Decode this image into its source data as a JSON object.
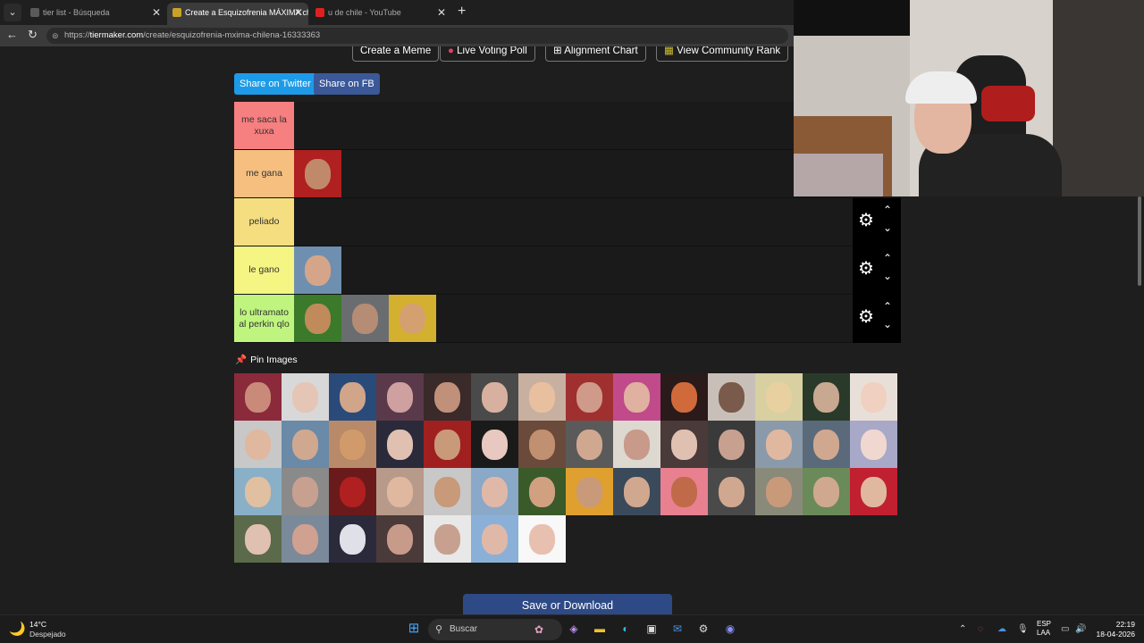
{
  "browser": {
    "tabs": [
      {
        "label": "tier list - Búsqueda",
        "active": false,
        "favicon_color": "#5a5a5a"
      },
      {
        "label": "Create a Esquizofrenia MÁXIMA ch",
        "active": true,
        "favicon_color": "#c9a228"
      },
      {
        "label": "u de chile - YouTube",
        "active": false,
        "favicon_color": "#e02020"
      }
    ],
    "url_prefix": "https://",
    "url_domain": "tiermaker.com",
    "url_path": "/create/esquizofrenia-mxima-chilena-16333363"
  },
  "toolbar": {
    "create_meme": "Create a Meme",
    "live_voting": "Live Voting Poll",
    "alignment_chart": "Alignment Chart",
    "community_rank": "View Community Rank"
  },
  "share": {
    "twitter": "Share on Twitter",
    "fb": "Share on FB"
  },
  "tiers": [
    {
      "label": "me saca la xuxa",
      "color": "#f67f7f",
      "items": []
    },
    {
      "label": "me gana",
      "color": "#f6bf80",
      "items": [
        {
          "bg": "#b02020",
          "skin": "#c08a6a"
        }
      ]
    },
    {
      "label": "peliado",
      "color": "#f5de80",
      "items": []
    },
    {
      "label": "le gano",
      "color": "#f5f584",
      "items": [
        {
          "bg": "#6f8fb0",
          "skin": "#d5a58a"
        }
      ]
    },
    {
      "label": "lo ultramato al perkin qlo",
      "color": "#bff57f",
      "items": [
        {
          "bg": "#3a7a2a",
          "skin": "#c08a5a"
        },
        {
          "bg": "#6a6d70",
          "skin": "#b58c74"
        },
        {
          "bg": "#d4b030",
          "skin": "#d5a070"
        }
      ]
    }
  ],
  "pin_images_label": "Pin Images",
  "pool": [
    {
      "bg": "#8a2a3a",
      "skin": "#c98a7a"
    },
    {
      "bg": "#d8d8d8",
      "skin": "#e5c5b5"
    },
    {
      "bg": "#2a4a7a",
      "skin": "#d0a58a"
    },
    {
      "bg": "#5a3a4a",
      "skin": "#cfa0a0"
    },
    {
      "bg": "#3a2a2a",
      "skin": "#c0907a"
    },
    {
      "bg": "#4a4a4a",
      "skin": "#d8b0a0"
    },
    {
      "bg": "#c8b0a0",
      "skin": "#e8c0a0"
    },
    {
      "bg": "#a03030",
      "skin": "#d09a8a"
    },
    {
      "bg": "#c04a8a",
      "skin": "#e0b0a0"
    },
    {
      "bg": "#2a1a1a",
      "skin": "#d06a3a"
    },
    {
      "bg": "#c8c0b8",
      "skin": "#7a5a4a"
    },
    {
      "bg": "#d8d0a0",
      "skin": "#e8d0a0"
    },
    {
      "bg": "#2a3a2a",
      "skin": "#c8a890"
    },
    {
      "bg": "#e8e0d8",
      "skin": "#f0d0c0"
    },
    {
      "bg": "#c8c8c8",
      "skin": "#e0b8a0"
    },
    {
      "bg": "#6a8aa8",
      "skin": "#d0a890"
    },
    {
      "bg": "#b88a6a",
      "skin": "#d09a6a"
    },
    {
      "bg": "#2a2a3a",
      "skin": "#e0c0b0"
    },
    {
      "bg": "#a02020",
      "skin": "#c89a7a"
    },
    {
      "bg": "#1a1a1a",
      "skin": "#e8c8c0"
    },
    {
      "bg": "#6a4a3a",
      "skin": "#c09070"
    },
    {
      "bg": "#5a5a5a",
      "skin": "#d0a890"
    },
    {
      "bg": "#ddd8d0",
      "skin": "#c89a8a"
    },
    {
      "bg": "#4a3a3a",
      "skin": "#e0c0b0"
    },
    {
      "bg": "#3a3a3a",
      "skin": "#c8a090"
    },
    {
      "bg": "#8a9aaa",
      "skin": "#e0b8a0"
    },
    {
      "bg": "#5a6a7a",
      "skin": "#d0a890"
    },
    {
      "bg": "#a8a8c8",
      "skin": "#f0d8d0"
    },
    {
      "bg": "#8ab0c8",
      "skin": "#e0c0a0"
    },
    {
      "bg": "#8a8a8a",
      "skin": "#c8a090"
    },
    {
      "bg": "#6a1a1a",
      "skin": "#b02020"
    },
    {
      "bg": "#b89a8a",
      "skin": "#e0b8a0"
    },
    {
      "bg": "#c8c8c8",
      "skin": "#c89a7a"
    },
    {
      "bg": "#8aa8c8",
      "skin": "#e0b8a8"
    },
    {
      "bg": "#3a5a2a",
      "skin": "#d0a080"
    },
    {
      "bg": "#e0a030",
      "skin": "#c89a7a"
    },
    {
      "bg": "#3a4a5a",
      "skin": "#d0a890"
    },
    {
      "bg": "#e88090",
      "skin": "#c06a4a"
    },
    {
      "bg": "#4a4a4a",
      "skin": "#d0a890"
    },
    {
      "bg": "#8a8a7a",
      "skin": "#c89a7a"
    },
    {
      "bg": "#6a8a5a",
      "skin": "#d0a890"
    },
    {
      "bg": "#c02030",
      "skin": "#e0b8a0"
    },
    {
      "bg": "#5a6a4a",
      "skin": "#e0c0b0"
    },
    {
      "bg": "#7a8a9a",
      "skin": "#d0a090"
    },
    {
      "bg": "#2a2a3a",
      "skin": "#e0e0e8"
    },
    {
      "bg": "#4a3a3a",
      "skin": "#c89a8a"
    },
    {
      "bg": "#e8e8e8",
      "skin": "#c8a090"
    },
    {
      "bg": "#8ab0d8",
      "skin": "#e0b8a8"
    },
    {
      "bg": "#f8f8f8",
      "skin": "#e8c0b0"
    }
  ],
  "save_button": "Save or Download",
  "taskbar": {
    "temp": "14°C",
    "weather": "Despejado",
    "search": "Buscar",
    "lang_1": "ESP",
    "lang_2": "LAA",
    "time": "22:19",
    "date": "18-04-2026"
  }
}
